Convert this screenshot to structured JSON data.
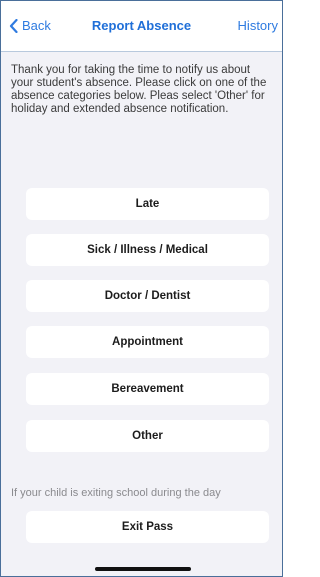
{
  "nav": {
    "back_label": "Back",
    "title": "Report Absence",
    "history_label": "History"
  },
  "intro": "Thank you for taking the time to notify us about your student's absence. Please click on one of the absence categories below. Pleas select 'Other' for holiday and extended absence notification.",
  "categories": [
    {
      "label": "Late"
    },
    {
      "label": "Sick / Illness / Medical"
    },
    {
      "label": "Doctor / Dentist"
    },
    {
      "label": "Appointment"
    },
    {
      "label": "Bereavement"
    },
    {
      "label": "Other"
    }
  ],
  "exit": {
    "note": "If your child is exiting school during the day",
    "button_label": "Exit Pass"
  }
}
